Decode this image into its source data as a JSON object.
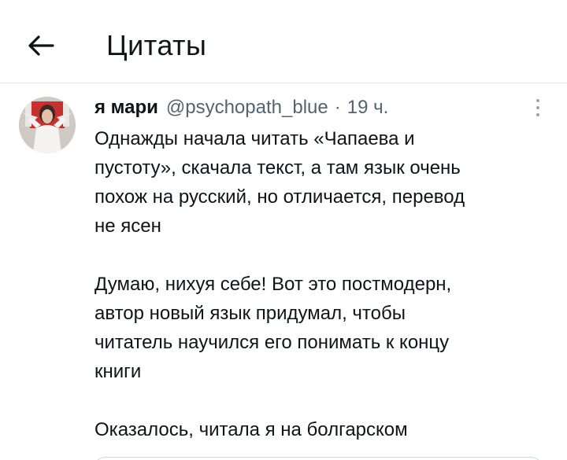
{
  "header": {
    "title": "Цитаты",
    "back_icon": "arrow-left-icon"
  },
  "tweet": {
    "author": {
      "display_name": "я мари",
      "handle": "@psychopath_blue",
      "avatar": "avatar-photo"
    },
    "separator": "·",
    "time": "19 ч.",
    "more_icon": "more-vertical-icon",
    "text_lines": [
      "Однажды начала читать «Чапаева и",
      "пустоту», скачала текст, а там язык очень",
      "похож на русский, но отличается, перевод",
      "не ясен",
      "",
      "Думаю, нихуя себе! Вот это постмодерн,",
      "автор новый язык придумал, чтобы",
      "читатель научился его понимать к концу",
      "книги",
      "",
      "Оказалось, читала я на болгарском"
    ]
  },
  "colors": {
    "text": "#0f1419",
    "secondary_text": "#536471",
    "divider": "#e6e9ec",
    "card_border": "#cfd9de",
    "background": "#ffffff"
  }
}
